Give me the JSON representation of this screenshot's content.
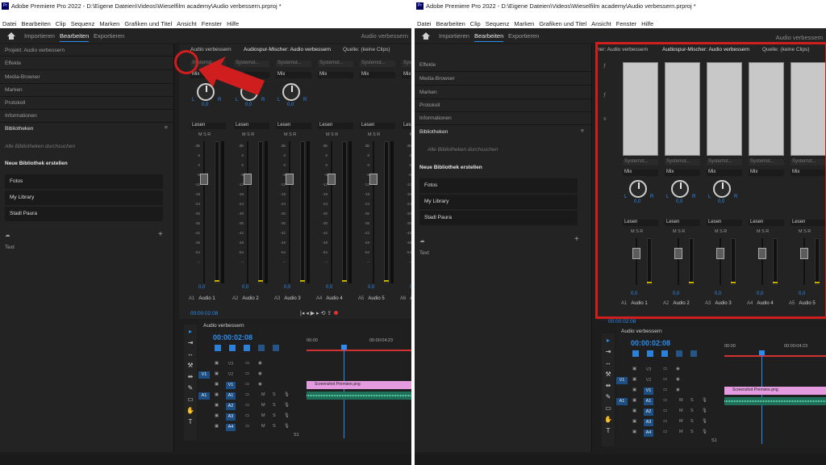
{
  "left": {
    "title": "Adobe Premiere Pro 2022 - D:\\Eigene Dateien\\Videos\\Wieselfilm academy\\Audio verbessern.prproj *",
    "menu": [
      "Datei",
      "Bearbeiten",
      "Clip",
      "Sequenz",
      "Marken",
      "Grafiken und Titel",
      "Ansicht",
      "Fenster",
      "Hilfe"
    ],
    "workspace_tabs": [
      "Importieren",
      "Bearbeiten",
      "Exportieren"
    ],
    "workspace_name": "Audio verbessern",
    "panels": [
      "Projekt: Audio verbessern",
      "Effekte",
      "Media-Browser",
      "Marken",
      "Protokoll",
      "Informationen",
      "Bibliotheken"
    ],
    "library_search_placeholder": "Alle Bibliotheken durchsuchen",
    "library_create": "Neue Bibliothek erstellen",
    "libraries": [
      "Fotos",
      "My Library",
      "Stadl Paura"
    ],
    "bottom_label": "Text",
    "mixer_tabs": [
      "Audio verbessern",
      "Audiospur-Mischer: Audio verbessern",
      "Quelle: (keine Clips)"
    ],
    "timecode": "00:00:02:08"
  },
  "right": {
    "title": "Adobe Premiere Pro 2022 - D:\\Eigene Dateien\\Videos\\Wieselfilm academy\\Audio verbessern.prproj *",
    "menu": [
      "Datei",
      "Bearbeiten",
      "Clip",
      "Sequenz",
      "Marken",
      "Grafiken und Titel",
      "Ansicht",
      "Fenster",
      "Hilfe"
    ],
    "workspace_tabs": [
      "Importieren",
      "Bearbeiten",
      "Exportieren"
    ],
    "workspace_name": "Audio verbessern",
    "panels": [
      "Effekte",
      "Media-Browser",
      "Marken",
      "Protokoll",
      "Informationen",
      "Bibliotheken"
    ],
    "library_search_placeholder": "Alle Bibliotheken durchsuchen",
    "library_create": "Neue Bibliothek erstellen",
    "libraries": [
      "Fotos",
      "My Library",
      "Stadl Paura"
    ],
    "bottom_label": "Text",
    "mixer_tabs": [
      "her: Audio verbessern",
      "Audiospur-Mischer: Audio verbessern",
      "Quelle: (keine Clips)"
    ],
    "timecode": "00:00:02:08"
  },
  "mixer_common": {
    "mix_label": "Mix",
    "read_label": "Lesen",
    "pan_value": "0,0",
    "knob_l": "L",
    "knob_r": "R",
    "msr": "M S R",
    "fader_zero": "0,0",
    "effect_slot": "Systemst...",
    "fader_scale": [
      "dB",
      "6",
      "0",
      "-6",
      "-12",
      "-18",
      "-24",
      "-30",
      "-36",
      "-42",
      "-48",
      "-54",
      "--"
    ],
    "tracks": [
      {
        "id": "A1",
        "name": "Audio 1"
      },
      {
        "id": "A2",
        "name": "Audio 2"
      },
      {
        "id": "A3",
        "name": "Audio 3"
      },
      {
        "id": "A4",
        "name": "Audio 4"
      },
      {
        "id": "A5",
        "name": "Audio 5"
      },
      {
        "id": "A6",
        "name": "A"
      }
    ]
  },
  "timeline": {
    "title": "Audio verbessern",
    "timecode": "00:00:02:08",
    "ruler_start": "00:00",
    "ruler_mark": "00:00:04:23",
    "clip_name": "Screenshot Premiere.png",
    "video_tracks": [
      "V3",
      "V2",
      "V1"
    ],
    "audio_tracks": [
      "A1",
      "A2",
      "A3",
      "A4"
    ],
    "source_v": "V1",
    "source_a": "A1",
    "track_m": "M",
    "track_s": "S",
    "mix_label": "S1"
  }
}
